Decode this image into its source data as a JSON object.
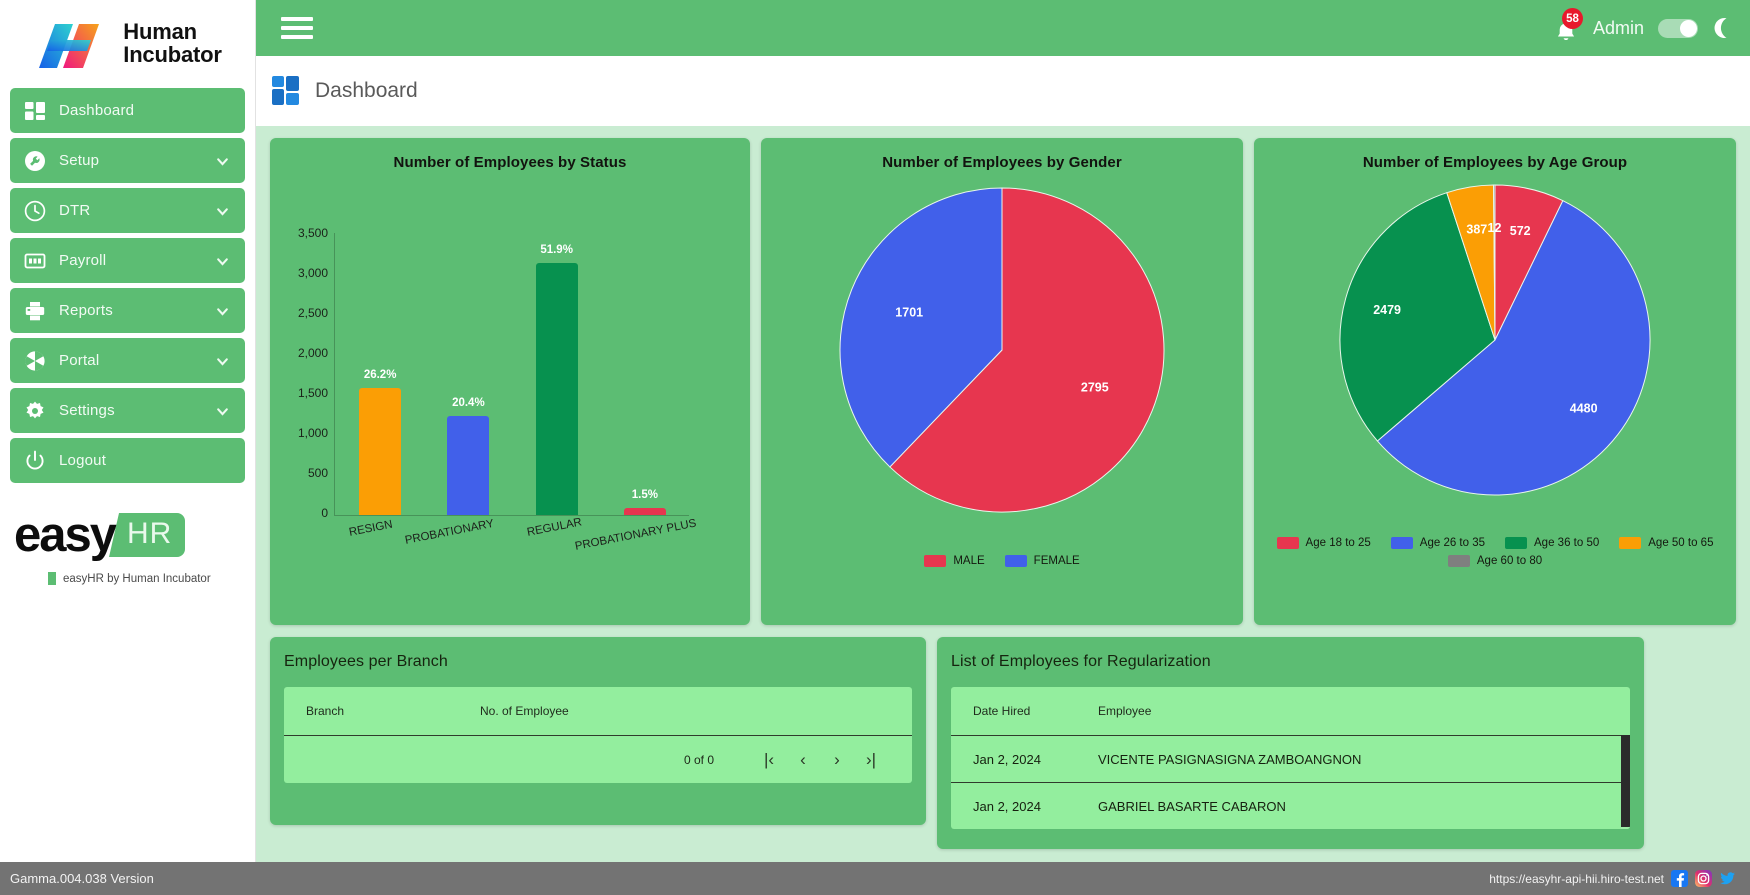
{
  "sidebar": {
    "brand": {
      "line1": "Human",
      "line2": "Incubator"
    },
    "items": [
      {
        "label": "Dashboard",
        "icon": "grid-icon",
        "expandable": false,
        "active": true
      },
      {
        "label": "Setup",
        "icon": "wrench-icon",
        "expandable": true
      },
      {
        "label": "DTR",
        "icon": "clock-icon",
        "expandable": true
      },
      {
        "label": "Payroll",
        "icon": "calculator-icon",
        "expandable": true
      },
      {
        "label": "Reports",
        "icon": "printer-icon",
        "expandable": true
      },
      {
        "label": "Portal",
        "icon": "aperture-icon",
        "expandable": true
      },
      {
        "label": "Settings",
        "icon": "gear-icon",
        "expandable": true
      },
      {
        "label": "Logout",
        "icon": "power-icon",
        "expandable": false
      }
    ],
    "product_logo": {
      "word": "easy",
      "tag": "HR",
      "subtitle": "easyHR by Human Incubator"
    }
  },
  "topbar": {
    "menu_icon": "hamburger-icon",
    "notification_icon": "bell-icon",
    "notification_count": "58",
    "user_name": "Admin",
    "theme_toggle_state": "on",
    "theme_icon": "moon-icon"
  },
  "pagehead": {
    "icon": "dashboard-icon",
    "title": "Dashboard"
  },
  "chart_data": [
    {
      "type": "bar",
      "title": "Number of Employees by Status",
      "categories": [
        "RESIGN",
        "PROBATIONARY",
        "REGULAR",
        "PROBATIONARY PLUS"
      ],
      "values": [
        1575,
        1228,
        3125,
        90
      ],
      "data_labels": [
        "26.2%",
        "20.4%",
        "51.9%",
        "1.5%"
      ],
      "colors": [
        "#fb9e05",
        "#4160ea",
        "#07914f",
        "#e7364f"
      ],
      "xlabel": "",
      "ylabel": "",
      "ylim": [
        0,
        3500
      ],
      "yticks": [
        "0",
        "500",
        "1,000",
        "1,500",
        "2,000",
        "2,500",
        "3,000",
        "3,500"
      ],
      "grid": false,
      "legend": "none"
    },
    {
      "type": "pie",
      "title": "Number of Employees by Gender",
      "categories": [
        "MALE",
        "FEMALE"
      ],
      "values": [
        2795,
        1701
      ],
      "colors": [
        "#e7364f",
        "#4160ea"
      ],
      "legend": "bottom"
    },
    {
      "type": "pie",
      "title": "Number of Employees by Age Group",
      "categories": [
        "Age 18 to 25",
        "Age 26 to 35",
        "Age 36 to 50",
        "Age 50 to 65",
        "Age 60 to 80"
      ],
      "values": [
        572,
        4480,
        2479,
        387,
        12
      ],
      "colors": [
        "#e7364f",
        "#4160ea",
        "#07914f",
        "#fb9e05",
        "#7f7f7f"
      ],
      "legend": "bottom"
    }
  ],
  "branch_panel": {
    "title": "Employees per Branch",
    "columns": [
      "Branch",
      "No. of Employee"
    ],
    "rows": [],
    "pagination": {
      "count_label": "0 of 0",
      "first_label": "|‹",
      "prev_label": "‹",
      "next_label": "›",
      "last_label": "›|"
    }
  },
  "regularization_panel": {
    "title": "List of Employees for Regularization",
    "columns": [
      "Date Hired",
      "Employee"
    ],
    "rows": [
      {
        "date_hired": "Jan 2, 2024",
        "employee": "VICENTE PASIGNASIGNA ZAMBOANGNON"
      },
      {
        "date_hired": "Jan 2, 2024",
        "employee": "GABRIEL BASARTE CABARON"
      }
    ]
  },
  "footer": {
    "version": "Gamma.004.038 Version",
    "url": "https://easyhr-api-hii.hiro-test.net",
    "social": [
      "facebook-icon",
      "instagram-icon",
      "twitter-icon"
    ]
  },
  "colors": {
    "brand_green": "#5cbd73",
    "panel_bg": "#c9ecd2",
    "table_green": "#93ee9e",
    "footer_gray": "#737373",
    "badge_red": "#e8192c"
  }
}
